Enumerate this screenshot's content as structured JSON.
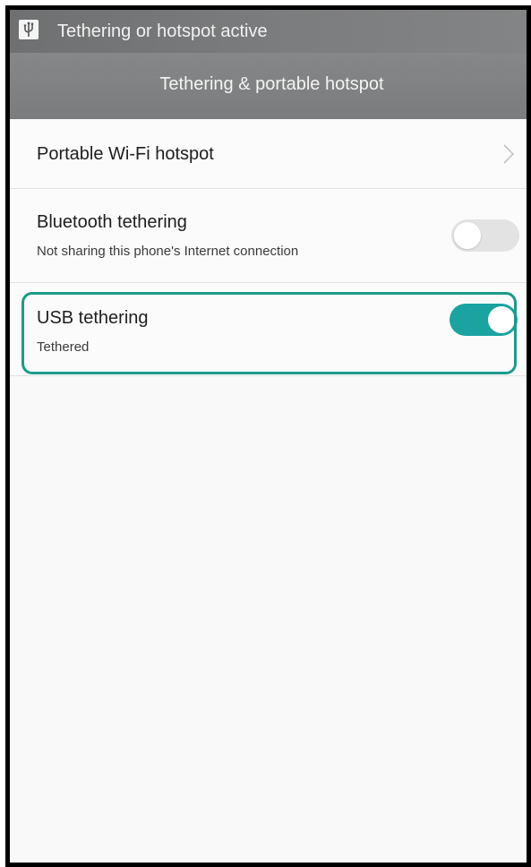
{
  "status_bar": {
    "notification_icon": "usb-icon",
    "notification_text": "Tethering or hotspot active"
  },
  "header": {
    "title": "Tethering & portable hotspot"
  },
  "settings": {
    "hotspot": {
      "title": "Portable Wi-Fi hotspot",
      "icon": "chevron-right-icon"
    },
    "bluetooth": {
      "title": "Bluetooth tethering",
      "subtitle": "Not sharing this phone's Internet connection",
      "enabled": false
    },
    "usb": {
      "title": "USB tethering",
      "subtitle": "Tethered",
      "enabled": true
    }
  },
  "colors": {
    "accent": "#1aa3a1",
    "highlight_border": "#1d9a8c",
    "header_gray": "#858687",
    "background": "#f9f9f9"
  }
}
